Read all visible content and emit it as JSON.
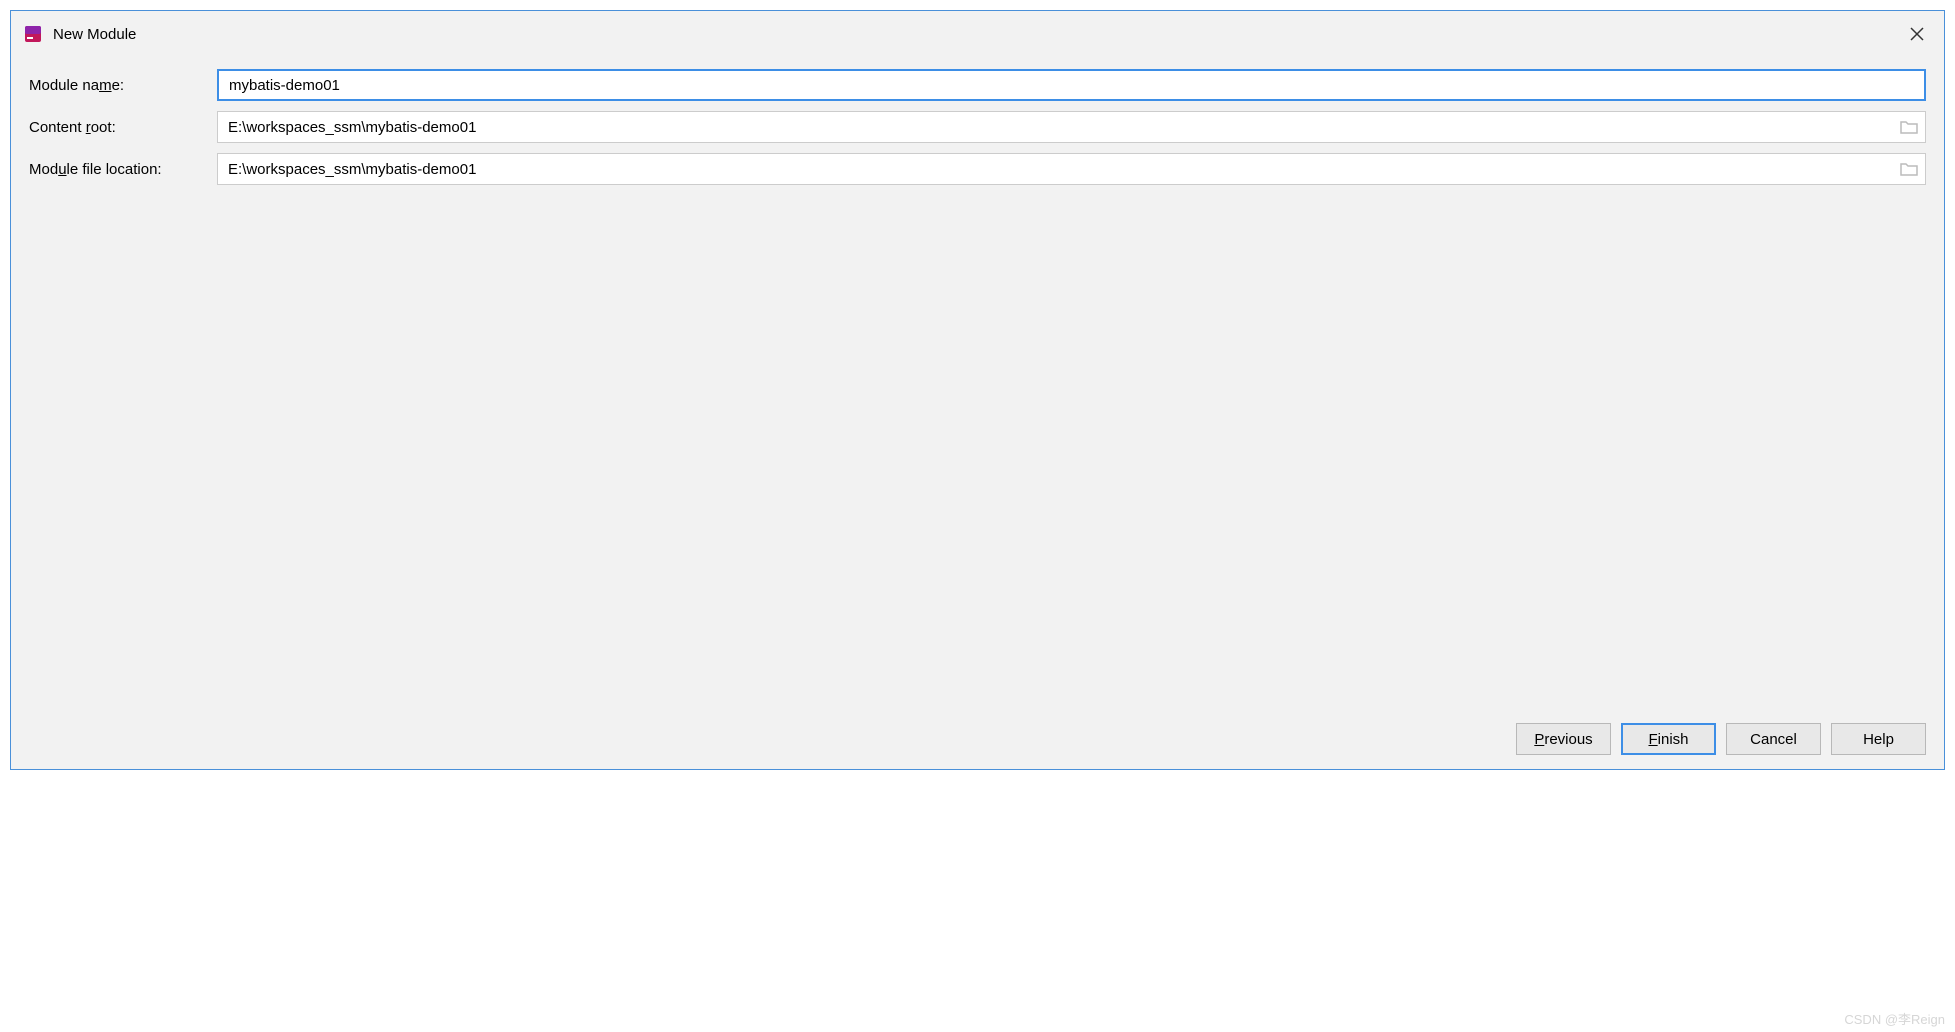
{
  "titlebar": {
    "title": "New Module"
  },
  "form": {
    "module_name": {
      "label_pre": "Module na",
      "label_u": "m",
      "label_post": "e:",
      "value": "mybatis-demo01"
    },
    "content_root": {
      "label_pre": "Content ",
      "label_u": "r",
      "label_post": "oot:",
      "value": "E:\\workspaces_ssm\\mybatis-demo01"
    },
    "module_file_location": {
      "label_pre": "Mod",
      "label_u": "u",
      "label_post": "le file location:",
      "value": "E:\\workspaces_ssm\\mybatis-demo01"
    }
  },
  "buttons": {
    "previous_u": "P",
    "previous_post": "revious",
    "finish_u": "F",
    "finish_post": "inish",
    "cancel": "Cancel",
    "help": "Help"
  },
  "watermark": "CSDN @李Reign"
}
